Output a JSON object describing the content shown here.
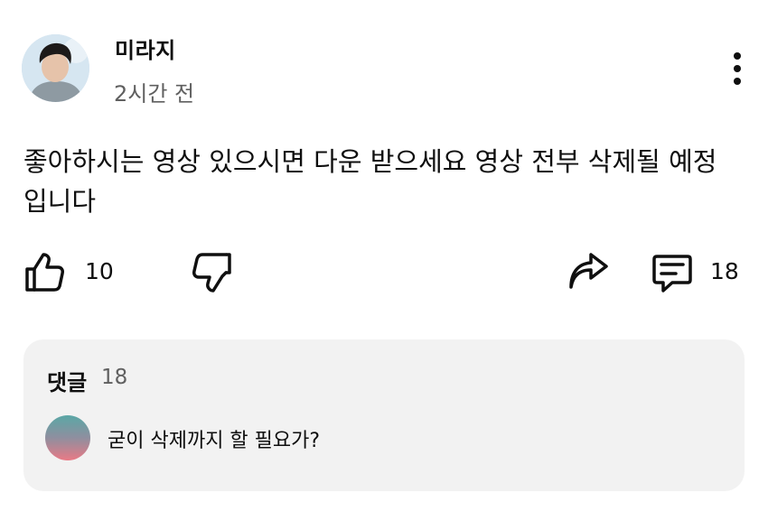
{
  "post": {
    "author": "미라지",
    "time": "2시간 전",
    "text": "좋아하시는 영상 있으시면 다운 받으세요 영상 전부 삭제될 예정 입니다"
  },
  "actions": {
    "like_count": "10",
    "comment_count": "18"
  },
  "comments": {
    "title": "댓글",
    "count": "18",
    "preview_text": "굳이 삭제까지 할 필요가?"
  },
  "icons": {
    "more": "more-vert-icon",
    "like": "thumbs-up-icon",
    "dislike": "thumbs-down-icon",
    "share": "share-icon",
    "comment": "comment-icon"
  }
}
